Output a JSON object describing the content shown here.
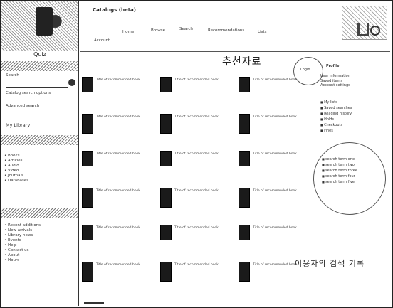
{
  "sidebar": {
    "caption": "Quiz",
    "search_label": "Search",
    "lines": [
      "Catalog search options",
      "Advanced search"
    ],
    "section_label": "My Library",
    "list_a": [
      "Books",
      "Articles",
      "Audio",
      "Video",
      "Journals",
      "Databases"
    ],
    "list_b": [
      "Recent additions",
      "New arrivals",
      "Library news",
      "Events",
      "Help",
      "Contact us",
      "About",
      "Hours"
    ]
  },
  "topbar": {
    "brand": "Catalogs (beta)",
    "nav": [
      "Home",
      "Browse",
      "Search",
      "Recommendations",
      "Lists",
      "Account"
    ]
  },
  "main": {
    "title": "추천자료",
    "items": [
      {
        "text": "Title of recommended book"
      },
      {
        "text": "Title of recommended book"
      },
      {
        "text": "Title of recommended book"
      },
      {
        "text": "Title of recommended book"
      },
      {
        "text": "Title of recommended book"
      },
      {
        "text": "Title of recommended book"
      },
      {
        "text": "Title of recommended book"
      },
      {
        "text": "Title of recommended book"
      },
      {
        "text": "Title of recommended book"
      },
      {
        "text": "Title of recommended book"
      },
      {
        "text": "Title of recommended book"
      },
      {
        "text": "Title of recommended book"
      },
      {
        "text": "Title of recommended book"
      },
      {
        "text": "Title of recommended book"
      },
      {
        "text": "Title of recommended book"
      },
      {
        "text": "Title of recommended book"
      },
      {
        "text": "Title of recommended book"
      },
      {
        "text": "Title of recommended book"
      }
    ]
  },
  "right": {
    "login": "Login",
    "profile_title": "Profile",
    "profile_lines": [
      "User information",
      "Saved items",
      "Account settings"
    ],
    "links": [
      "My lists",
      "Saved searches",
      "Reading history",
      "Holds",
      "Checkouts",
      "Fines"
    ],
    "history": [
      "search term one",
      "search term two",
      "search term three",
      "search term four",
      "search term five"
    ],
    "history_label": "이용자의 검색 기록"
  }
}
